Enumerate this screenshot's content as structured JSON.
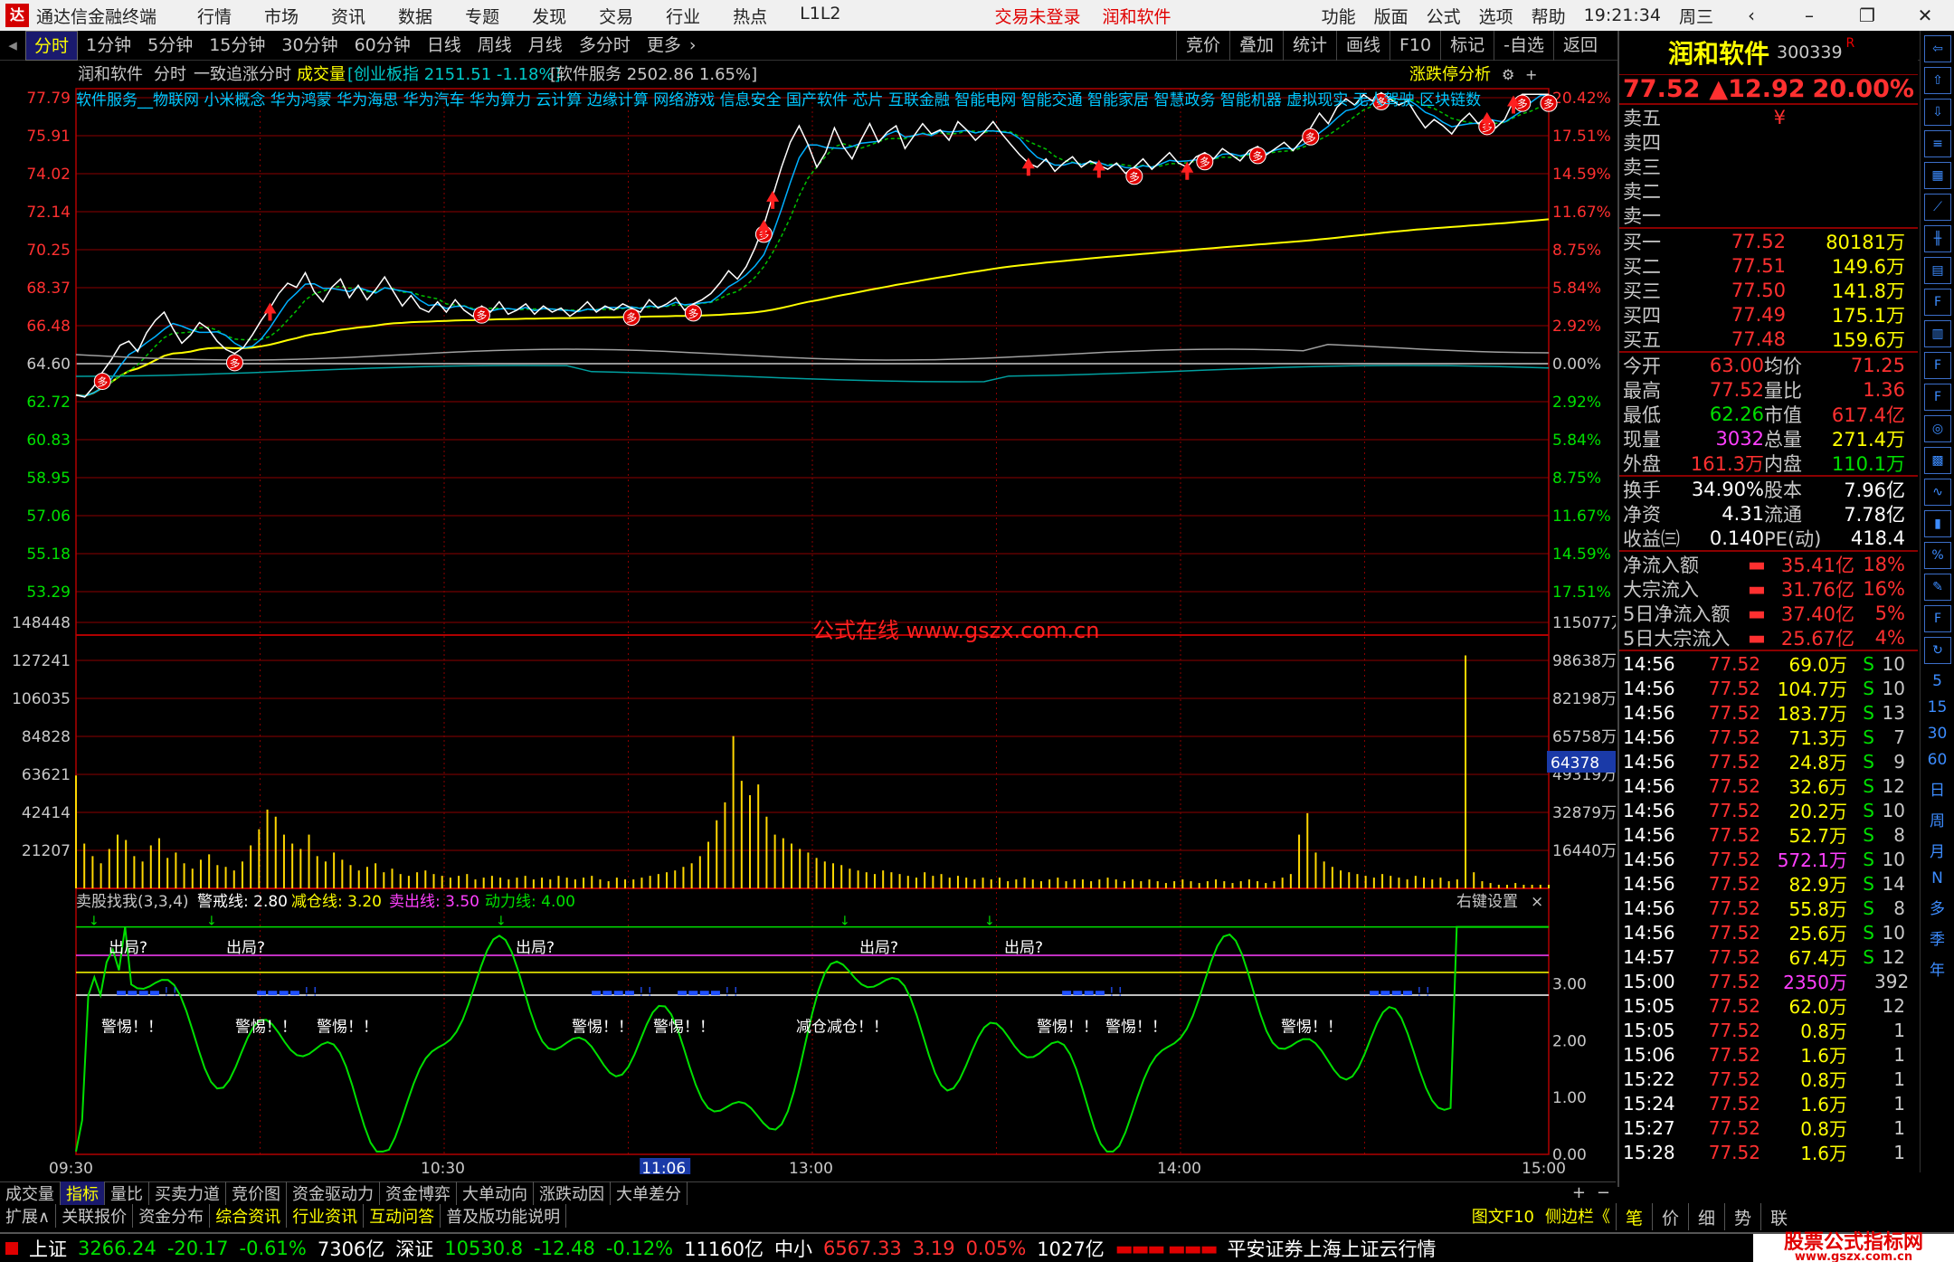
{
  "titlebar": {
    "app_name": "通达信金融终端",
    "menu": [
      "行情",
      "市场",
      "资讯",
      "数据",
      "专题",
      "发现",
      "交易",
      "行业",
      "热点",
      "L1L2"
    ],
    "center": [
      "交易未登录",
      "润和软件"
    ],
    "right": [
      "功能",
      "版面",
      "公式",
      "选项",
      "帮助"
    ],
    "time": "19:21:34",
    "weekday": "周三"
  },
  "toolbar": {
    "tabs": [
      "分时",
      "1分钟",
      "5分钟",
      "15分钟",
      "30分钟",
      "60分钟",
      "日线",
      "周线",
      "月线",
      "多分时",
      "更多"
    ],
    "active": "分时",
    "right": [
      "竞价",
      "叠加",
      "统计",
      "画线",
      "F10",
      "标记",
      "-自选",
      "返回"
    ]
  },
  "chart_header": {
    "stock": "润和软件",
    "mode": "分时",
    "formula": "一致追涨分时",
    "vol_label": "成交量",
    "idx1": "[创业板指 2151.51 -1.18%]",
    "idx2": "[软件服务 2502.86 1.65%]",
    "limit_btn": "涨跌停分析",
    "concepts": "软件服务__物联网 小米概念 华为鸿蒙 华为海思 华为汽车 华为算力 云计算 边缘计算 网络游戏 信息安全 国产软件 芯片 互联金融 智能电网 智能交通 智能家居 智慧政务 智能机器 虚拟现实 无人驾驶 区块链数"
  },
  "watermark": "公式在线 www.gszx.com.cn",
  "price_axis": {
    "left": [
      "77.79",
      "75.91",
      "74.02",
      "72.14",
      "70.25",
      "68.37",
      "66.48",
      "64.60",
      "62.72",
      "60.83",
      "58.95",
      "57.06",
      "55.18",
      "53.29"
    ],
    "right": [
      "20.42%",
      "17.51%",
      "14.59%",
      "11.67%",
      "8.75%",
      "5.84%",
      "2.92%",
      "0.00%",
      "2.92%",
      "5.84%",
      "8.75%",
      "11.67%",
      "14.59%",
      "17.51%"
    ]
  },
  "vol_axis": {
    "left": [
      "148448",
      "127241",
      "106035",
      "84828",
      "63621",
      "42414",
      "21207"
    ],
    "right": [
      "115077万",
      "98638万",
      "82198万",
      "65758万",
      "49319万",
      "32879万",
      "16440万"
    ],
    "cursor": "64378"
  },
  "indicator": {
    "name": "卖股找我(3,3,4)",
    "l1": "警戒线: 2.80",
    "l2": "减仓线: 3.20",
    "l3": "卖出线: 3.50",
    "l4": "动力线: 4.00",
    "setting": "右键设置",
    "close": "×",
    "axis": [
      "3.00",
      "2.00",
      "1.00",
      "0.00"
    ],
    "tag_out": "出局?",
    "tag_warn": "警惕！！",
    "tag_reduce": "减仓减仓！！"
  },
  "time_axis": {
    "labels": [
      "09:30",
      "10:30",
      "11:06",
      "13:00",
      "14:00",
      "15:00"
    ]
  },
  "chart_data": {
    "type": "line",
    "x_range": [
      0,
      240
    ],
    "prev_close": 64.6,
    "ylim_price": [
      51.41,
      77.79
    ],
    "price": [
      63.0,
      62.9,
      63.4,
      64.1,
      64.7,
      65.4,
      65.6,
      65.1,
      66.0,
      66.6,
      67.0,
      66.2,
      65.5,
      65.9,
      66.5,
      66.2,
      65.6,
      65.2,
      65.0,
      65.3,
      65.9,
      66.6,
      67.2,
      67.9,
      68.4,
      68.2,
      68.9,
      68.0,
      67.5,
      68.2,
      68.6,
      67.7,
      68.3,
      67.6,
      68.1,
      68.7,
      68.0,
      67.3,
      67.8,
      67.2,
      67.0,
      67.5,
      67.0,
      67.6,
      67.1,
      66.8,
      67.3,
      67.0,
      67.5,
      66.9,
      67.1,
      67.4,
      66.9,
      67.3,
      67.0,
      67.2,
      66.8,
      67.1,
      67.5,
      67.0,
      67.3,
      67.1,
      67.4,
      67.2,
      67.0,
      67.6,
      67.2,
      67.4,
      67.7,
      67.1,
      67.4,
      67.6,
      67.9,
      68.4,
      69.0,
      68.6,
      69.2,
      70.1,
      71.2,
      72.6,
      74.0,
      75.2,
      76.0,
      75.1,
      74.0,
      74.7,
      75.9,
      75.0,
      74.4,
      75.3,
      76.1,
      75.2,
      75.7,
      76.0,
      74.9,
      75.5,
      76.1,
      75.6,
      75.8,
      75.3,
      76.2,
      75.8,
      75.3,
      75.7,
      76.2,
      75.6,
      75.1,
      74.6,
      74.2,
      74.0,
      74.4,
      73.8,
      74.2,
      74.5,
      74.0,
      74.3,
      74.1,
      73.9,
      74.2,
      73.7,
      74.0,
      74.4,
      73.9,
      74.3,
      74.7,
      74.2,
      74.0,
      74.5,
      74.7,
      74.4,
      74.9,
      74.6,
      74.3,
      74.8,
      75.0,
      74.6,
      74.9,
      75.2,
      74.8,
      75.3,
      75.9,
      76.6,
      76.1,
      76.9,
      77.3,
      77.0,
      77.5,
      77.2,
      77.6,
      77.3,
      77.0,
      77.2,
      76.5,
      75.9,
      76.3,
      76.0,
      75.6,
      76.2,
      76.6,
      76.1,
      76.4,
      75.9,
      76.3,
      77.2,
      77.52,
      77.52,
      77.52,
      77.52
    ],
    "volume": [
      63000,
      25000,
      18000,
      14000,
      22000,
      30000,
      27000,
      18000,
      15000,
      24000,
      28000,
      17000,
      20000,
      14000,
      11000,
      16000,
      19000,
      13000,
      12000,
      10000,
      15000,
      24000,
      33000,
      44000,
      40000,
      30000,
      25000,
      22000,
      30000,
      18000,
      15000,
      20000,
      16000,
      13000,
      10000,
      12000,
      14000,
      9000,
      11000,
      8000,
      7000,
      9000,
      10000,
      8000,
      7000,
      6000,
      7000,
      8000,
      5000,
      6000,
      7000,
      6000,
      5000,
      6000,
      7000,
      5000,
      6000,
      5000,
      7000,
      6000,
      5000,
      6000,
      7000,
      5000,
      4000,
      6000,
      5000,
      5000,
      6000,
      7000,
      8000,
      9000,
      10000,
      12000,
      14000,
      18000,
      26000,
      38000,
      48000,
      85000,
      60000,
      52000,
      58000,
      40000,
      30000,
      28000,
      25000,
      22000,
      20000,
      17000,
      15000,
      14000,
      13000,
      11000,
      10000,
      9000,
      8000,
      10000,
      9000,
      8000,
      7000,
      6000,
      9000,
      7000,
      8000,
      6000,
      7000,
      6000,
      5000,
      6000,
      5000,
      6000,
      4000,
      5000,
      6000,
      5000,
      4000,
      5000,
      6000,
      4000,
      5000,
      5000,
      4000,
      5000,
      6000,
      5000,
      4000,
      5000,
      4000,
      5000,
      4000,
      3000,
      4000,
      5000,
      4000,
      3000,
      4000,
      5000,
      4000,
      3000,
      4000,
      5000,
      4000,
      3000,
      4000,
      6000,
      8000,
      30000,
      42000,
      20000,
      15000,
      12000,
      10000,
      9000,
      8000,
      7000,
      6000,
      8000,
      7000,
      6000,
      5000,
      7000,
      6000,
      5000,
      6000,
      4000,
      5000,
      130000,
      9000,
      4000,
      3000,
      2000,
      2000,
      3000,
      2000,
      2000,
      2000,
      2000
    ]
  },
  "quote": {
    "name": "润和软件",
    "code": "300339",
    "badge": "R",
    "price": "77.52",
    "change": "▲12.92",
    "pct": "20.00%",
    "sell": [
      {
        "l": "卖五",
        "p": "¥",
        "v": ""
      },
      {
        "l": "卖四",
        "p": "",
        "v": ""
      },
      {
        "l": "卖三",
        "p": "",
        "v": ""
      },
      {
        "l": "卖二",
        "p": "",
        "v": ""
      },
      {
        "l": "卖一",
        "p": "",
        "v": ""
      }
    ],
    "buy": [
      {
        "l": "买一",
        "p": "77.52",
        "v": "80181万"
      },
      {
        "l": "买二",
        "p": "77.51",
        "v": "149.6万"
      },
      {
        "l": "买三",
        "p": "77.50",
        "v": "141.8万"
      },
      {
        "l": "买四",
        "p": "77.49",
        "v": "175.1万"
      },
      {
        "l": "买五",
        "p": "77.48",
        "v": "159.6万"
      }
    ],
    "stats": [
      {
        "a": "今开",
        "av": "63.00",
        "b": "均价",
        "bv": "71.25"
      },
      {
        "a": "最高",
        "av": "77.52",
        "b": "量比",
        "bv": "1.36"
      },
      {
        "a": "最低",
        "av": "62.26",
        "b": "市值",
        "bv": "617.4亿"
      },
      {
        "a": "现量",
        "av": "3032",
        "b": "总量",
        "bv": "271.4万"
      },
      {
        "a": "外盘",
        "av": "161.3万",
        "b": "内盘",
        "bv": "110.1万"
      }
    ],
    "stats2": [
      {
        "a": "换手",
        "av": "34.90%",
        "b": "股本",
        "bv": "7.96亿"
      },
      {
        "a": "净资",
        "av": "4.31",
        "b": "流通",
        "bv": "7.78亿"
      },
      {
        "a": "收益㈢",
        "av": "0.140",
        "b": "PE(动)",
        "bv": "418.4"
      }
    ],
    "flows": [
      {
        "l": "净流入额",
        "v": "35.41亿",
        "p": "18%"
      },
      {
        "l": "大宗流入",
        "v": "31.76亿",
        "p": "16%"
      },
      {
        "l": "5日净流入额",
        "v": "37.40亿",
        "p": "5%"
      },
      {
        "l": "5日大宗流入",
        "v": "25.67亿",
        "p": "4%"
      }
    ],
    "ticks": [
      {
        "t": "14:56",
        "p": "77.52",
        "v": "69.0万",
        "s": "S",
        "n": "10"
      },
      {
        "t": "14:56",
        "p": "77.52",
        "v": "104.7万",
        "s": "S",
        "n": "10"
      },
      {
        "t": "14:56",
        "p": "77.52",
        "v": "183.7万",
        "s": "S",
        "n": "13"
      },
      {
        "t": "14:56",
        "p": "77.52",
        "v": "71.3万",
        "s": "S",
        "n": "7"
      },
      {
        "t": "14:56",
        "p": "77.52",
        "v": "24.8万",
        "s": "S",
        "n": "9"
      },
      {
        "t": "14:56",
        "p": "77.52",
        "v": "32.6万",
        "s": "S",
        "n": "12"
      },
      {
        "t": "14:56",
        "p": "77.52",
        "v": "20.2万",
        "s": "S",
        "n": "10"
      },
      {
        "t": "14:56",
        "p": "77.52",
        "v": "52.7万",
        "s": "S",
        "n": "8"
      },
      {
        "t": "14:56",
        "p": "77.52",
        "v": "572.1万",
        "s": "S",
        "n": "10"
      },
      {
        "t": "14:56",
        "p": "77.52",
        "v": "82.9万",
        "s": "S",
        "n": "14"
      },
      {
        "t": "14:56",
        "p": "77.52",
        "v": "55.8万",
        "s": "S",
        "n": "8"
      },
      {
        "t": "14:56",
        "p": "77.52",
        "v": "25.6万",
        "s": "S",
        "n": "10"
      },
      {
        "t": "14:57",
        "p": "77.52",
        "v": "67.4万",
        "s": "S",
        "n": "12"
      },
      {
        "t": "15:00",
        "p": "77.52",
        "v": "2350万",
        "s": "",
        "n": "392"
      },
      {
        "t": "15:05",
        "p": "77.52",
        "v": "62.0万",
        "s": "",
        "n": "12"
      },
      {
        "t": "15:05",
        "p": "77.52",
        "v": "0.8万",
        "s": "",
        "n": "1"
      },
      {
        "t": "15:06",
        "p": "77.52",
        "v": "1.6万",
        "s": "",
        "n": "1"
      },
      {
        "t": "15:22",
        "p": "77.52",
        "v": "0.8万",
        "s": "",
        "n": "1"
      },
      {
        "t": "15:24",
        "p": "77.52",
        "v": "1.6万",
        "s": "",
        "n": "1"
      },
      {
        "t": "15:27",
        "p": "77.52",
        "v": "0.8万",
        "s": "",
        "n": "1"
      },
      {
        "t": "15:28",
        "p": "77.52",
        "v": "1.6万",
        "s": "",
        "n": "1"
      }
    ]
  },
  "rtabs": [
    "笔",
    "价",
    "细",
    "势",
    "联"
  ],
  "iconcol": [
    "5",
    "15",
    "30",
    "60",
    "日",
    "周",
    "月",
    "N",
    "多",
    "季",
    "年"
  ],
  "bottom_tabs": [
    "成交量",
    "指标",
    "量比",
    "买卖力道",
    "竞价图",
    "资金驱动力",
    "资金博弈",
    "大单动向",
    "涨跌动因",
    "大单差分"
  ],
  "bottom_tabs_active": "指标",
  "ext_bar": [
    "扩展∧",
    "关联报价",
    "资金分布",
    "综合资讯",
    "行业资讯",
    "互动问答",
    "普及版功能说明"
  ],
  "ext_right": [
    "图文F10",
    "侧边栏《"
  ],
  "status": {
    "sh_name": "上证",
    "sh_val": "3266.24",
    "sh_chg": "-20.17",
    "sh_pct": "-0.61%",
    "sh_amt": "7306亿",
    "sz_name": "深证",
    "sz_val": "10530.8",
    "sz_chg": "-12.48",
    "sz_pct": "-0.12%",
    "sz_amt": "11160亿",
    "zx_name": "中小",
    "zx_val": "6567.33",
    "zx_chg": "3.19",
    "zx_pct": "0.05%",
    "zx_amt": "1027亿",
    "broker": "平安证券上海上证云行情",
    "brand": "股票公式指标网",
    "brand_url": "www.gszx.com.cn"
  }
}
